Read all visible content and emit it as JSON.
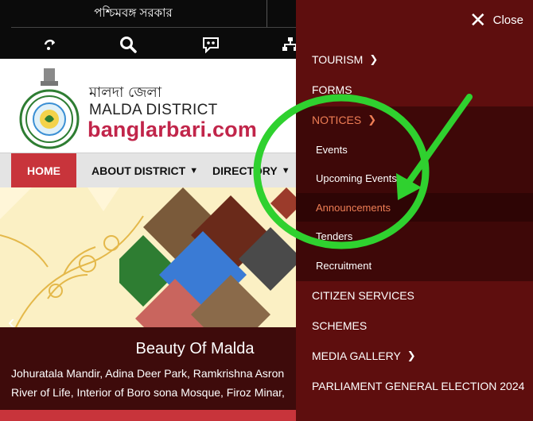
{
  "topbar": {
    "gov_text": "পশ্চিমবঙ্গ সরকার",
    "icons": [
      "share-icon",
      "search-icon",
      "accessibility-icon",
      "sitemap-icon"
    ]
  },
  "header": {
    "bn_title": "মালদা জেলা",
    "en_title": "MALDA DISTRICT",
    "brand": "banglarbari.com"
  },
  "nav": {
    "items": [
      {
        "label": "HOME"
      },
      {
        "label": "ABOUT DISTRICT"
      },
      {
        "label": "DIRECTORY"
      }
    ]
  },
  "banner": {
    "caption_title": "Beauty Of Malda",
    "caption_line1": "Johuratala Mandir, Adina Deer Park, Ramkrishna Asron",
    "caption_line2": "River of Life, Interior of Boro sona Mosque, Firoz Minar,"
  },
  "drawer": {
    "close_label": "Close",
    "items": [
      {
        "label": "TOURISM"
      },
      {
        "label": "FORMS"
      },
      {
        "label": "NOTICES"
      },
      {
        "label": "CITIZEN SERVICES"
      },
      {
        "label": "SCHEMES"
      },
      {
        "label": "MEDIA GALLERY"
      },
      {
        "label": "PARLIAMENT GENERAL ELECTION 2024"
      }
    ],
    "notices_sub": [
      {
        "label": "Events"
      },
      {
        "label": "Upcoming Events"
      },
      {
        "label": "Announcements"
      },
      {
        "label": "Tenders"
      },
      {
        "label": "Recruitment"
      }
    ]
  },
  "colors": {
    "drawer_bg": "#5e0e0e",
    "submenu_bg": "#3e0808",
    "accent_orange": "#ef7e55",
    "brand_red": "#c1254a",
    "home_red": "#c8343b",
    "annotation_green": "#2fd12f"
  }
}
